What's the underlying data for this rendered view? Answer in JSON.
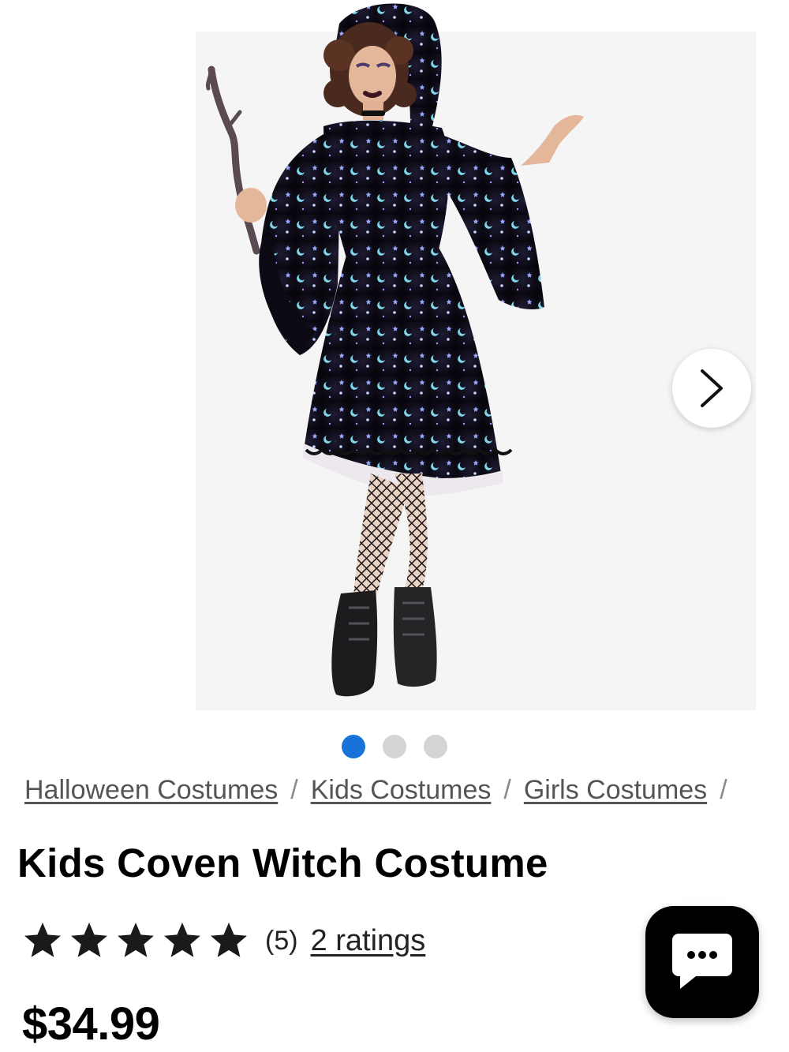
{
  "product": {
    "title": "Kids Coven Witch Costume",
    "image_alt": "Girl wearing a black hooded witch dress with iridescent moons and stars, fishnet tights and black boots, holding a twig wand",
    "price": "$34.99",
    "rating_stars": 5,
    "rating_count": "(5)",
    "ratings_link": "2 ratings"
  },
  "gallery": {
    "slide_count": 3,
    "active_slide": 1,
    "next_icon": "chevron-right-icon"
  },
  "breadcrumb": {
    "items": [
      "Halloween Costumes",
      "Kids Costumes",
      "Girls Costumes"
    ],
    "separator": "/"
  },
  "chat": {
    "icon": "chat-bubble-icon"
  },
  "colors": {
    "active_dot": "#1872d8",
    "inactive_dot": "#d4d4d4",
    "star": "#1a1a1a"
  }
}
